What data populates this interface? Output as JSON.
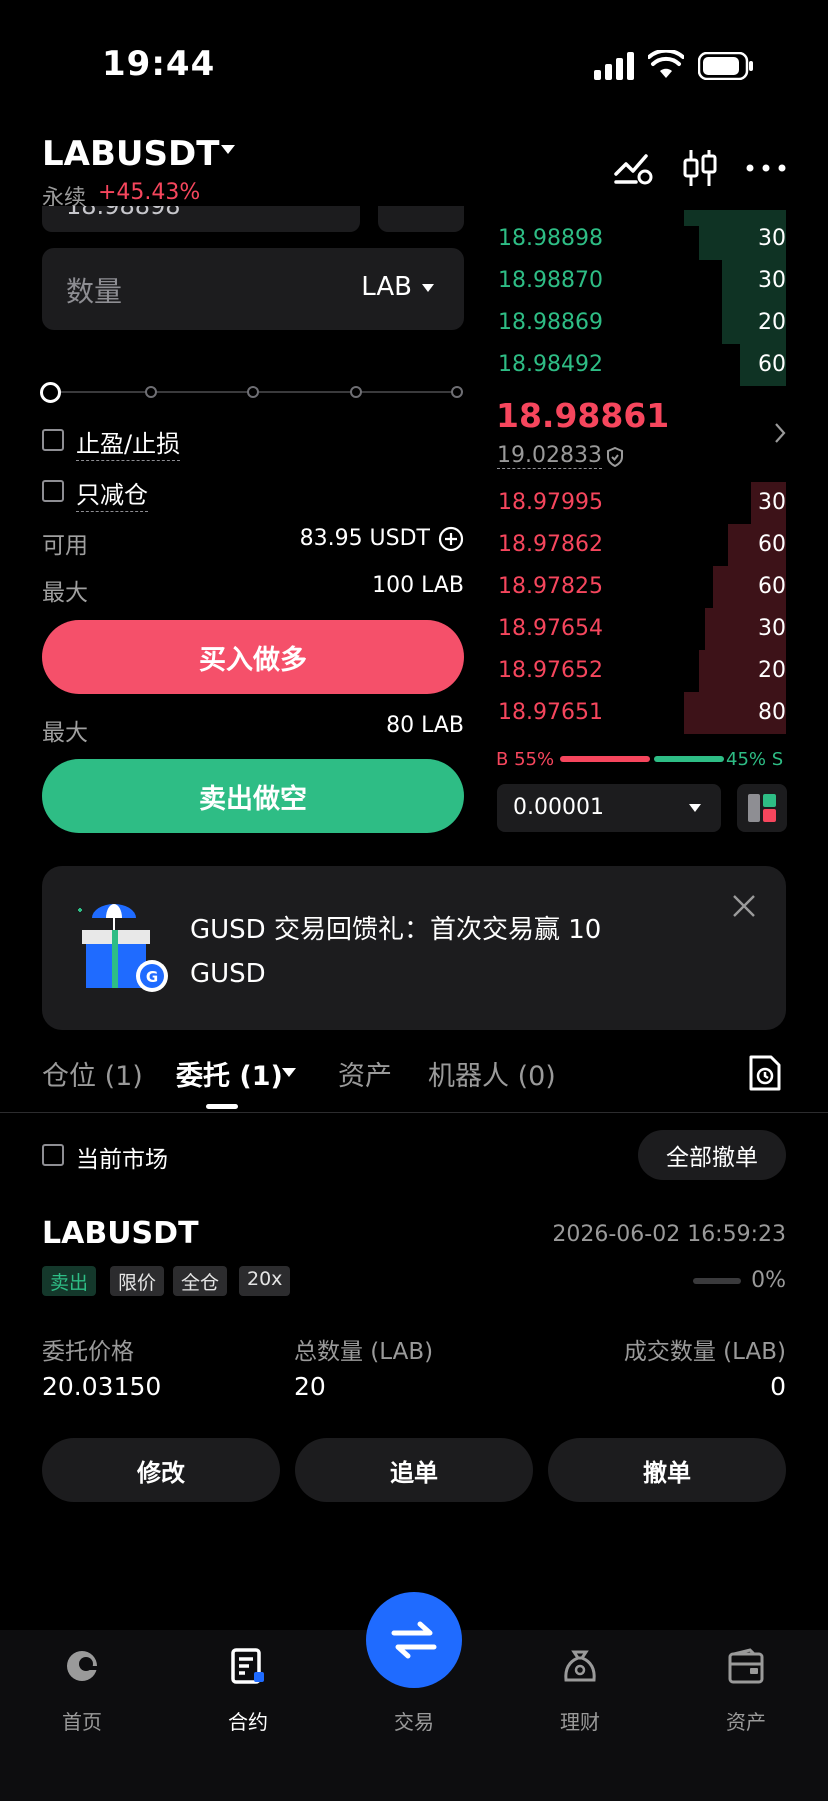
{
  "status_bar": {
    "time": "19:44"
  },
  "header": {
    "symbol": "LABUSDT",
    "contract_type": "永续",
    "change_pct": "+45.43%"
  },
  "order_form": {
    "quantity_label": "数量",
    "quantity_unit": "LAB",
    "tp_sl_label": "止盈/止损",
    "reduce_only_label": "只减仓",
    "available_label": "可用",
    "available_value": "83.95 USDT",
    "max_buy_label": "最大",
    "max_buy_value": "100 LAB",
    "buy_button": "买入做多",
    "max_sell_label": "最大",
    "max_sell_value": "80 LAB",
    "sell_button": "卖出做空"
  },
  "order_book": {
    "asks": [
      {
        "price": "18.98898",
        "qty": "30",
        "depth": 0.3
      },
      {
        "price": "18.98870",
        "qty": "30",
        "depth": 0.22
      },
      {
        "price": "18.98869",
        "qty": "20",
        "depth": 0.22
      },
      {
        "price": "18.98492",
        "qty": "60",
        "depth": 0.16
      }
    ],
    "last_price": "18.98861",
    "index_price": "19.02833",
    "bids": [
      {
        "price": "18.97995",
        "qty": "30",
        "depth": 0.12
      },
      {
        "price": "18.97862",
        "qty": "60",
        "depth": 0.2
      },
      {
        "price": "18.97825",
        "qty": "60",
        "depth": 0.25
      },
      {
        "price": "18.97654",
        "qty": "30",
        "depth": 0.28
      },
      {
        "price": "18.97652",
        "qty": "20",
        "depth": 0.3
      },
      {
        "price": "18.97651",
        "qty": "80",
        "depth": 0.35
      }
    ],
    "buy_ratio": "B 55%",
    "sell_ratio": "45% S",
    "precision": "0.00001"
  },
  "promo": {
    "text": "GUSD 交易回馈礼：首次交易赢 10 GUSD"
  },
  "tabs": {
    "positions": "仓位 (1)",
    "orders": "委托 (1)",
    "assets": "资产",
    "bots": "机器人 (0)"
  },
  "filter": {
    "current_market": "当前市场",
    "cancel_all": "全部撤单"
  },
  "order": {
    "symbol": "LABUSDT",
    "time": "2026-06-02 16:59:23",
    "tags": [
      "卖出",
      "限价",
      "全仓",
      "20x"
    ],
    "fill_pct": "0%",
    "price_label": "委托价格",
    "price_value": "20.03150",
    "total_label": "总数量 (LAB)",
    "total_value": "20",
    "filled_label": "成交数量 (LAB)",
    "filled_value": "0",
    "modify": "修改",
    "chase": "追单",
    "cancel": "撤单"
  },
  "bottom_nav": {
    "home": "首页",
    "futures": "合约",
    "trade": "交易",
    "earn": "理财",
    "assets": "资产"
  },
  "colors": {
    "green": "#2ebd85",
    "red": "#f6465d",
    "accent": "#1f6bff"
  }
}
